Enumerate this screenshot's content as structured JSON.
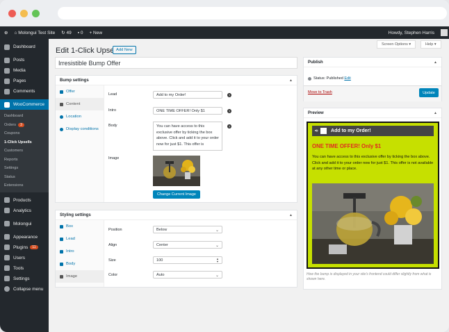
{
  "adminbar": {
    "site": "Molongui Test Site",
    "updates": "49",
    "comments": "0",
    "new": "+ New",
    "greeting": "Howdy, Stephen Harris"
  },
  "sidebar": {
    "items_top": [
      {
        "label": "Dashboard"
      },
      {
        "label": "Posts"
      },
      {
        "label": "Media"
      },
      {
        "label": "Pages"
      },
      {
        "label": "Comments"
      }
    ],
    "woocommerce": "WooCommerce",
    "sub": [
      "Dashboard",
      "Orders",
      "Coupons",
      "1-Click Upsells",
      "Customers",
      "Reports",
      "Settings",
      "Status",
      "Extensions"
    ],
    "orders_badge": "3",
    "items_mid": [
      {
        "label": "Products"
      },
      {
        "label": "Analytics"
      }
    ],
    "molongui": "Molongui",
    "items_bot": [
      {
        "label": "Appearance"
      },
      {
        "label": "Plugins"
      },
      {
        "label": "Users"
      },
      {
        "label": "Tools"
      },
      {
        "label": "Settings"
      },
      {
        "label": "Collapse menu"
      }
    ],
    "plugins_badge": "11"
  },
  "screen_options": "Screen Options ▾",
  "help": "Help ▾",
  "page_title": "Edit 1-Click Upsell",
  "add_new": "Add New",
  "post_title": "Irresistible Bump Offer",
  "bump": {
    "heading": "Bump settings",
    "tabs": [
      "Offer",
      "Content",
      "Location",
      "Display conditions"
    ],
    "lead_label": "Lead",
    "lead_value": "Add to my Order!",
    "intro_label": "Intro",
    "intro_value": "ONE TIME OFFER! Only $1",
    "body_label": "Body",
    "body_value": "You can have access to this exclusive offer by ticking the box above. Click and add it to your order now for just $1. This offer is",
    "image_label": "Image",
    "change_image": "Change Current Image"
  },
  "styling": {
    "heading": "Styling settings",
    "tabs": [
      "Box",
      "Lead",
      "Intro",
      "Body",
      "Image"
    ],
    "position_label": "Position",
    "position_value": "Below",
    "align_label": "Align",
    "align_value": "Center",
    "size_label": "Size",
    "size_value": "100",
    "color_label": "Color",
    "color_value": "Auto"
  },
  "publish": {
    "heading": "Publish",
    "status_label": "Status: Published",
    "edit": "Edit",
    "trash": "Move to Trash",
    "update": "Update"
  },
  "preview": {
    "heading": "Preview",
    "lead": "Add to my Order!",
    "intro": "ONE TIME OFFER! Only $1",
    "body": "You can have access to this exclusive offer by ticking the box above. Click and add it to your order now for just $1. This offer is not available at any other time or place.",
    "note": "How the bump is displayed in your site's frontend could differ slightly from what is shown here.",
    "bg_color": "#c6e000",
    "intro_color": "#e02b20"
  }
}
